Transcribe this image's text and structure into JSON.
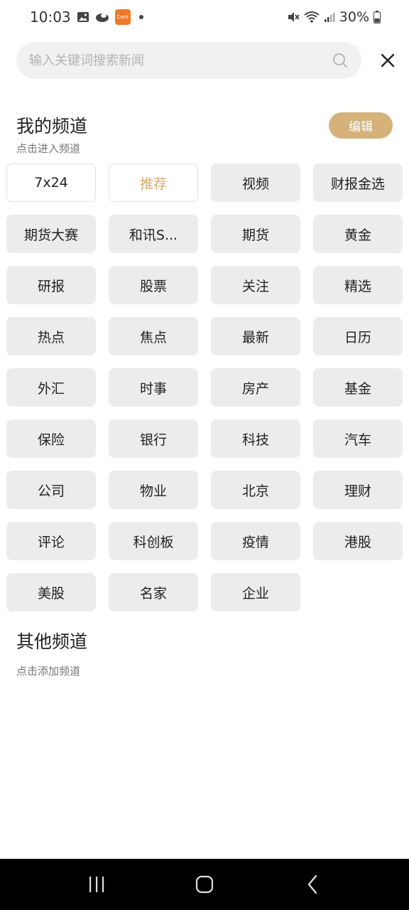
{
  "status_bar": {
    "time": "10:03",
    "battery": "30%",
    "app_badge_text": "Cent"
  },
  "search": {
    "placeholder": "输入关键词搜索新闻",
    "value": ""
  },
  "my_channels": {
    "title": "我的频道",
    "subtitle": "点击进入频道",
    "edit_label": "编辑",
    "items": [
      {
        "label": "7x24"
      },
      {
        "label": "推荐"
      },
      {
        "label": "视频"
      },
      {
        "label": "财报金选"
      },
      {
        "label": "期货大赛"
      },
      {
        "label": "和讯S..."
      },
      {
        "label": "期货"
      },
      {
        "label": "黄金"
      },
      {
        "label": "研报"
      },
      {
        "label": "股票"
      },
      {
        "label": "关注"
      },
      {
        "label": "精选"
      },
      {
        "label": "热点"
      },
      {
        "label": "焦点"
      },
      {
        "label": "最新"
      },
      {
        "label": "日历"
      },
      {
        "label": "外汇"
      },
      {
        "label": "时事"
      },
      {
        "label": "房产"
      },
      {
        "label": "基金"
      },
      {
        "label": "保险"
      },
      {
        "label": "银行"
      },
      {
        "label": "科技"
      },
      {
        "label": "汽车"
      },
      {
        "label": "公司"
      },
      {
        "label": "物业"
      },
      {
        "label": "北京"
      },
      {
        "label": "理财"
      },
      {
        "label": "评论"
      },
      {
        "label": "科创板"
      },
      {
        "label": "疫情"
      },
      {
        "label": "港股"
      },
      {
        "label": "美股"
      },
      {
        "label": "名家"
      },
      {
        "label": "企业"
      }
    ]
  },
  "other_channels": {
    "title": "其他频道",
    "subtitle": "点击添加频道"
  },
  "colors": {
    "accent": "#d5b27a",
    "active_text": "#d5ab6c",
    "chip_bg": "#ececec"
  }
}
